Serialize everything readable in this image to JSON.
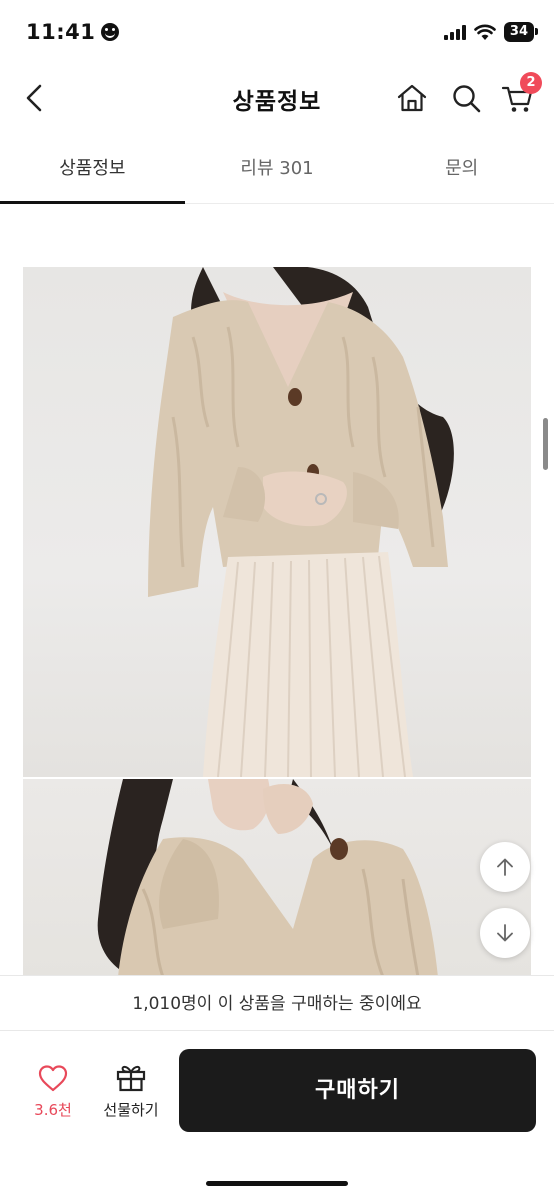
{
  "status_bar": {
    "time": "11:41",
    "battery": "34"
  },
  "header": {
    "title": "상품정보",
    "cart_count": "2"
  },
  "tabs": [
    {
      "label": "상품정보",
      "active": true
    },
    {
      "label": "리뷰 301",
      "active": false
    },
    {
      "label": "문의",
      "active": false
    }
  ],
  "banner": {
    "text": "1,010명이 이 상품을 구매하는 중이에요"
  },
  "bottom_bar": {
    "like_count": "3.6천",
    "gift_label": "선물하기",
    "buy_label": "구매하기"
  },
  "icons": {
    "back": "chevron-left-icon",
    "home": "home-icon",
    "search": "search-icon",
    "cart": "cart-icon",
    "heart": "heart-icon",
    "gift": "gift-icon",
    "scroll_up": "arrow-up-icon",
    "scroll_down": "arrow-down-icon"
  },
  "colors": {
    "accent": "#f04b5a",
    "buy_button": "#1b1b1b"
  }
}
